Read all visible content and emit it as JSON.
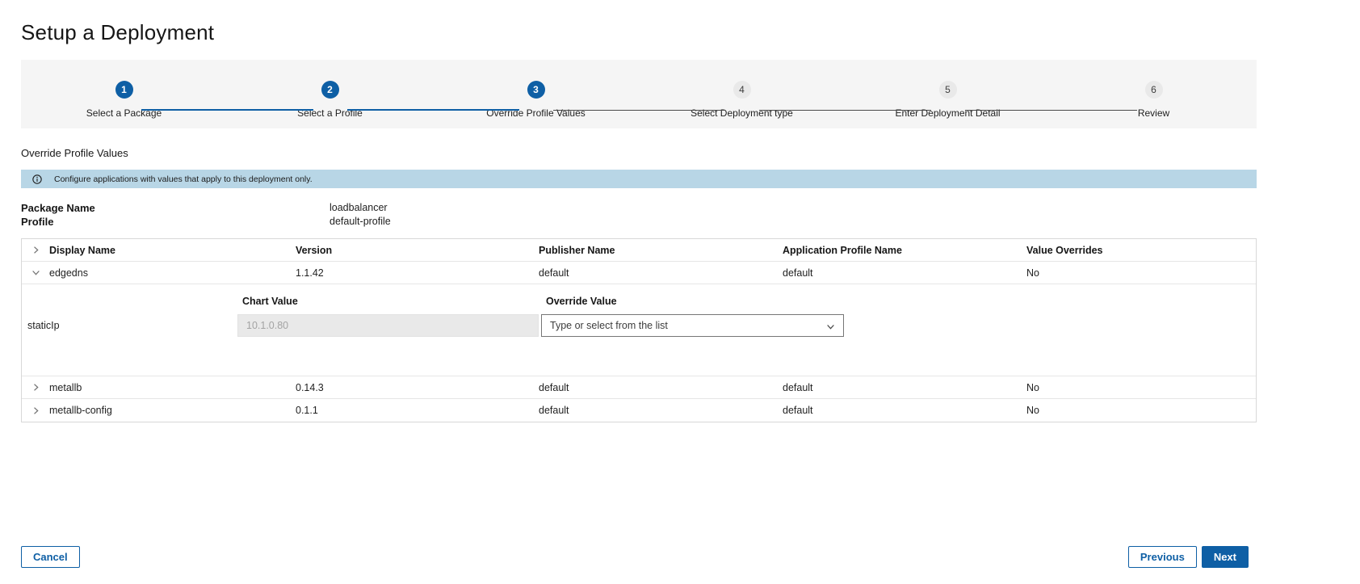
{
  "page": {
    "title": "Setup a Deployment"
  },
  "stepper": {
    "steps": [
      {
        "number": "1",
        "label": "Select a Package",
        "state": "complete"
      },
      {
        "number": "2",
        "label": "Select a Profile",
        "state": "complete"
      },
      {
        "number": "3",
        "label": "Override Profile Values",
        "state": "active"
      },
      {
        "number": "4",
        "label": "Select Deployment type",
        "state": "upcoming"
      },
      {
        "number": "5",
        "label": "Enter Deployment Detail",
        "state": "upcoming"
      },
      {
        "number": "6",
        "label": "Review",
        "state": "upcoming"
      }
    ]
  },
  "section": {
    "heading": "Override Profile Values"
  },
  "banner": {
    "text": "Configure applications with values that apply to this deployment only.",
    "background": "#b8d6e6"
  },
  "package_info": {
    "package_name_label": "Package Name",
    "package_name_value": "loadbalancer",
    "profile_label": "Profile",
    "profile_value": "default-profile"
  },
  "table": {
    "headers": {
      "display_name": "Display Name",
      "version": "Version",
      "publisher_name": "Publisher Name",
      "application_profile_name": "Application Profile Name",
      "value_overrides": "Value Overrides"
    },
    "rows": [
      {
        "display_name": "edgedns",
        "version": "1.1.42",
        "publisher_name": "default",
        "application_profile_name": "default",
        "value_overrides": "No",
        "expanded": true
      },
      {
        "display_name": "metallb",
        "version": "0.14.3",
        "publisher_name": "default",
        "application_profile_name": "default",
        "value_overrides": "No",
        "expanded": false
      },
      {
        "display_name": "metallb-config",
        "version": "0.1.1",
        "publisher_name": "default",
        "application_profile_name": "default",
        "value_overrides": "No",
        "expanded": false
      }
    ],
    "expanded_detail": {
      "param_name": "staticIp",
      "chart_value_label": "Chart Value",
      "chart_value": "10.1.0.80",
      "override_value_label": "Override Value",
      "override_placeholder": "Type or select from the list"
    }
  },
  "footer": {
    "cancel_label": "Cancel",
    "previous_label": "Previous",
    "next_label": "Next"
  },
  "colors": {
    "primary_blue": "#0e5fa5"
  }
}
